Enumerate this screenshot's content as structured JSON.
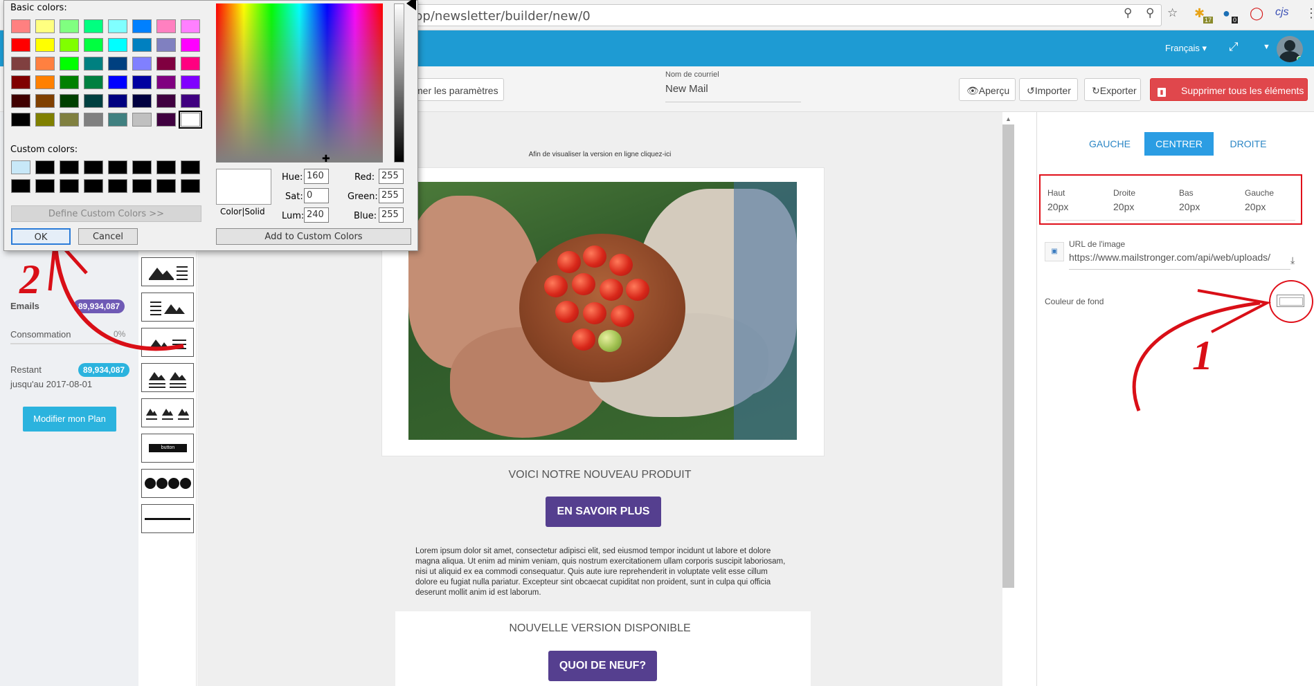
{
  "browser": {
    "url": "pp/newsletter/builder/new/0",
    "ext_badge_1": "17",
    "ext_badge_2": "0",
    "ext_cjs": "cjs"
  },
  "topnav": {
    "language": "Français",
    "accent": "#1e9bd3"
  },
  "toolbar": {
    "settings_label": "mer les paramètres",
    "mail_name_label": "Nom de courriel",
    "mail_name_value": "New Mail",
    "preview_label": "Aperçu",
    "import_label": "Importer",
    "export_label": "Exporter",
    "delete_label": "Supprimer tous les éléments"
  },
  "left_panel": {
    "emails_label": "Emails",
    "emails_value": "89,934,087",
    "consumption_label": "Consommation",
    "consumption_value": "0%",
    "remaining_label": "Restant",
    "remaining_value": "89,934,087",
    "until_label": "jusqu'au 2017-08-01",
    "plan_button": "Modifier mon Plan"
  },
  "blocks": {
    "button_thumb_label": "button"
  },
  "canvas": {
    "view_online_link": "Afin de visualiser la version en ligne cliquez-ici",
    "heading_1": "VOICI NOTRE NOUVEAU PRODUIT",
    "cta_1": "EN SAVOIR PLUS",
    "lorem": "Lorem ipsum dolor sit amet, consectetur adipisci elit, sed eiusmod tempor incidunt ut labore et dolore magna aliqua. Ut enim ad minim veniam, quis nostrum exercitationem ullam corporis suscipit laboriosam, nisi ut aliquid ex ea commodi consequatur. Quis aute iure reprehenderit in voluptate velit esse cillum dolore eu fugiat nulla pariatur. Excepteur sint obcaecat cupiditat non proident, sunt in culpa qui officia deserunt mollit anim id est laborum.",
    "heading_2": "NOUVELLE VERSION DISPONIBLE",
    "cta_2": "QUOI DE NEUF?",
    "cta_color": "#553f8f"
  },
  "right_panel": {
    "align_left": "GAUCHE",
    "align_center": "CENTRER",
    "align_right": "DROITE",
    "padding": [
      {
        "label": "Haut",
        "value": "20px"
      },
      {
        "label": "Droite",
        "value": "20px"
      },
      {
        "label": "Bas",
        "value": "20px"
      },
      {
        "label": "Gauche",
        "value": "20px"
      }
    ],
    "image_url_label": "URL de l'image",
    "image_url_value": "https://www.mailstronger.com/api/web/uploads/",
    "bg_color_label": "Couleur de fond"
  },
  "color_dialog": {
    "basic_colors_label": "Basic colors:",
    "custom_colors_label": "Custom colors:",
    "define_custom_button": "Define Custom Colors >>",
    "ok_button": "OK",
    "cancel_button": "Cancel",
    "color_solid_label": "Color|Solid",
    "hue_label": "Hue:",
    "hue_value": "160",
    "sat_label": "Sat:",
    "sat_value": "0",
    "lum_label": "Lum:",
    "lum_value": "240",
    "red_label": "Red:",
    "red_value": "255",
    "green_label": "Green:",
    "green_value": "255",
    "blue_label": "Blue:",
    "blue_value": "255",
    "add_custom_button": "Add to Custom Colors",
    "basic_colors": [
      "#ff8080",
      "#ffff80",
      "#80ff80",
      "#00ff80",
      "#80ffff",
      "#0080ff",
      "#ff80c0",
      "#ff80ff",
      "#ff0000",
      "#ffff00",
      "#80ff00",
      "#00ff40",
      "#00ffff",
      "#0080c0",
      "#8080c0",
      "#ff00ff",
      "#804040",
      "#ff8040",
      "#00ff00",
      "#008080",
      "#004080",
      "#8080ff",
      "#800040",
      "#ff0080",
      "#800000",
      "#ff8000",
      "#008000",
      "#008040",
      "#0000ff",
      "#0000a0",
      "#800080",
      "#8000ff",
      "#400000",
      "#804000",
      "#004000",
      "#004040",
      "#000080",
      "#000040",
      "#400040",
      "#400080",
      "#000000",
      "#808000",
      "#808040",
      "#808080",
      "#408080",
      "#c0c0c0",
      "#400040",
      "#ffffff"
    ],
    "custom_colors": [
      "#c8e8f8",
      "#000000",
      "#000000",
      "#000000",
      "#000000",
      "#000000",
      "#000000",
      "#000000",
      "#000000",
      "#000000",
      "#000000",
      "#000000",
      "#000000",
      "#000000",
      "#000000",
      "#000000"
    ]
  },
  "annotations": {
    "step_1": "1",
    "step_2": "2",
    "color": "#d90f17"
  }
}
